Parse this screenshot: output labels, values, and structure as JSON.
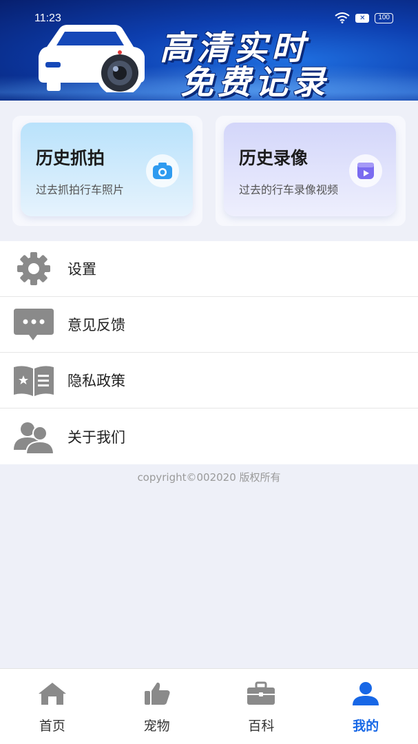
{
  "status_bar": {
    "time": "11:23",
    "battery": "100"
  },
  "banner": {
    "line1": "高清实时",
    "line2": "免费记录"
  },
  "cards": [
    {
      "title": "历史抓拍",
      "subtitle": "过去抓拍行车照片",
      "icon": "camera-icon",
      "color": "#2e9bf0"
    },
    {
      "title": "历史录像",
      "subtitle": "过去的行车录像视频",
      "icon": "video-icon",
      "color": "#7a6bf0"
    }
  ],
  "menu": [
    {
      "label": "设置",
      "icon": "gear-icon"
    },
    {
      "label": "意见反馈",
      "icon": "chat-bubble-icon"
    },
    {
      "label": "隐私政策",
      "icon": "book-icon"
    },
    {
      "label": "关于我们",
      "icon": "users-icon"
    }
  ],
  "footer": {
    "copyright": "copyright©002020 版权所有"
  },
  "tabs": [
    {
      "label": "首页",
      "icon": "home-icon",
      "active": false
    },
    {
      "label": "宠物",
      "icon": "thumbs-up-icon",
      "active": false
    },
    {
      "label": "百科",
      "icon": "briefcase-icon",
      "active": false
    },
    {
      "label": "我的",
      "icon": "person-icon",
      "active": true
    }
  ],
  "colors": {
    "accent": "#1767e6",
    "icon_gray": "#8a8a8a",
    "background": "#eef0f8"
  }
}
